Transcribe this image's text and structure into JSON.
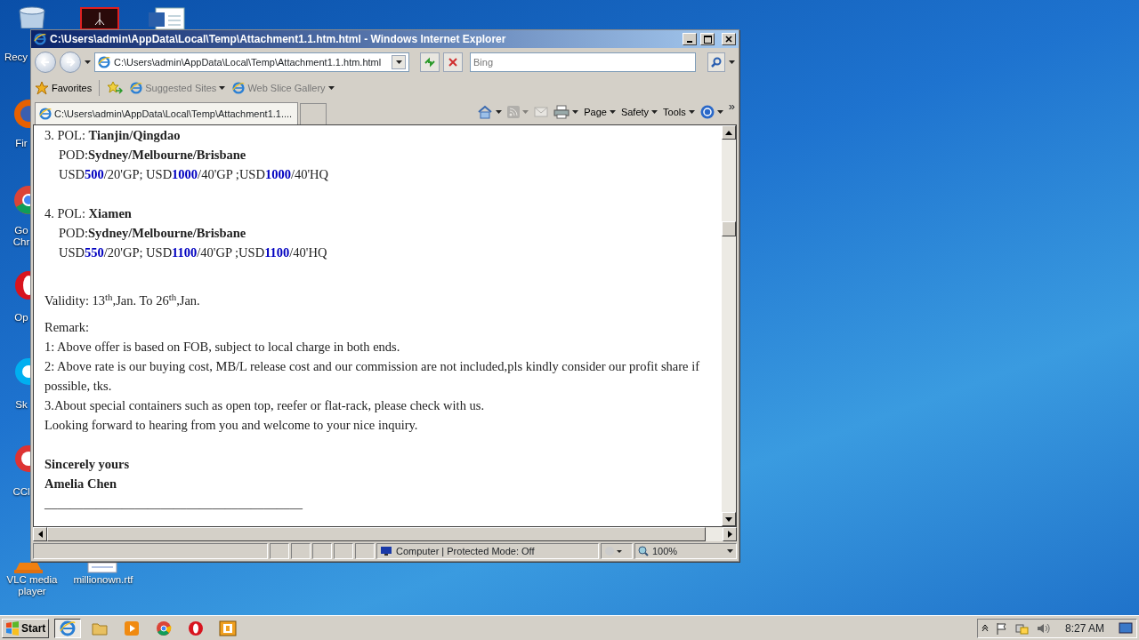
{
  "desktop_icons": [
    {
      "kind": "recycle",
      "label": "Recy"
    },
    {
      "kind": "pdf"
    },
    {
      "kind": "word"
    },
    {
      "kind": "firefox",
      "label": "Fir"
    },
    {
      "kind": "chrome",
      "label": "Go Chr"
    },
    {
      "kind": "opera",
      "label": "Op"
    },
    {
      "kind": "skype",
      "label": "Sk"
    },
    {
      "kind": "ccleaner",
      "label": "CCl"
    },
    {
      "kind": "vlc",
      "label": "VLC media player"
    },
    {
      "kind": "rtf",
      "label": "millionown.rtf"
    }
  ],
  "window": {
    "title": "C:\\Users\\admin\\AppData\\Local\\Temp\\Attachment1.1.htm.html - Windows Internet Explorer",
    "address": "C:\\Users\\admin\\AppData\\Local\\Temp\\Attachment1.1.htm.html",
    "search": {
      "placeholder": "Bing"
    },
    "favorites": {
      "label": "Favorites",
      "links": [
        {
          "label": "Suggested Sites"
        },
        {
          "label": "Web Slice Gallery"
        }
      ]
    },
    "tabs": [
      {
        "label": "C:\\Users\\admin\\AppData\\Local\\Temp\\Attachment1.1....",
        "selected": true
      }
    ],
    "commands": [
      {
        "kind": "home",
        "dropdown": true,
        "disabled": false
      },
      {
        "kind": "feed",
        "dropdown": true,
        "disabled": true
      },
      {
        "kind": "mail",
        "dropdown": false,
        "disabled": true
      },
      {
        "kind": "print",
        "dropdown": true,
        "disabled": false
      },
      {
        "kind": "text",
        "label": "Page",
        "dropdown": true,
        "disabled": false
      },
      {
        "kind": "text",
        "label": "Safety",
        "dropdown": true,
        "disabled": false
      },
      {
        "kind": "text",
        "label": "Tools",
        "dropdown": true,
        "disabled": false
      },
      {
        "kind": "help",
        "dropdown": true,
        "disabled": false
      }
    ],
    "overflow": "»",
    "status": {
      "zone": "Computer | Protected Mode: Off",
      "zoom": "100%"
    }
  },
  "document": [
    {
      "kind": "line",
      "text": "3. POL: **Tianjin/Qingdao**",
      "indent": false
    },
    {
      "kind": "line",
      "text": "POD:**Sydney/Melbourne/Brisbane**",
      "indent": true
    },
    {
      "kind": "prices",
      "segments": [
        {
          "text": "USD",
          "highlight": false
        },
        {
          "text": "500",
          "highlight": true
        },
        {
          "text": "/20'GP; USD",
          "highlight": false
        },
        {
          "text": "1000",
          "highlight": true
        },
        {
          "text": "/40'GP ;USD",
          "highlight": false
        },
        {
          "text": "1000",
          "highlight": true
        },
        {
          "text": "/40'HQ",
          "highlight": false
        }
      ]
    },
    {
      "kind": "gap"
    },
    {
      "kind": "line",
      "text": "4. POL: **Xiamen**",
      "indent": false
    },
    {
      "kind": "line",
      "text": "POD:**Sydney/Melbourne/Brisbane**",
      "indent": true
    },
    {
      "kind": "prices",
      "segments": [
        {
          "text": "USD",
          "highlight": false
        },
        {
          "text": "550",
          "highlight": true
        },
        {
          "text": "/20'GP; USD",
          "highlight": false
        },
        {
          "text": "1100",
          "highlight": true
        },
        {
          "text": "/40'GP ;USD",
          "highlight": false
        },
        {
          "text": "1100",
          "highlight": true
        },
        {
          "text": "/40'HQ",
          "highlight": false
        }
      ]
    },
    {
      "kind": "gap"
    },
    {
      "kind": "line",
      "text": "Validity: 13$^{th}$,Jan. To 26$^{th}$,Jan.",
      "indent": false,
      "tall": true
    },
    {
      "kind": "line",
      "text": "Remark:",
      "indent": false
    },
    {
      "kind": "line",
      "text": "1: Above offer is based on FOB, subject to local charge in both ends.",
      "indent": false
    },
    {
      "kind": "line",
      "text": "2: Above rate is our buying cost, MB/L release cost and our commission are not included,pls kindly consider our profit share if possible, tks.",
      "indent": false
    },
    {
      "kind": "line",
      "text": "3.About special containers such as open top, reefer or flat-rack, please check with us.",
      "indent": false
    },
    {
      "kind": "line",
      "text": "Looking forward to hearing from you and welcome to your nice inquiry.",
      "indent": false
    },
    {
      "kind": "gap"
    },
    {
      "kind": "line",
      "text": "Sincerely yours",
      "indent": false,
      "bold": true
    },
    {
      "kind": "line",
      "text": "Amelia Chen",
      "indent": false,
      "bold": true
    },
    {
      "kind": "line",
      "text": "________________________________________",
      "indent": false
    }
  ],
  "taskbar": {
    "start": "Start",
    "apps": [
      {
        "kind": "ie",
        "selected": true
      },
      {
        "kind": "folder",
        "selected": false
      },
      {
        "kind": "media",
        "selected": false
      },
      {
        "kind": "chrome",
        "selected": false
      },
      {
        "kind": "opera",
        "selected": false
      },
      {
        "kind": "outlook",
        "selected": false
      }
    ],
    "clock": "8:27 AM"
  }
}
